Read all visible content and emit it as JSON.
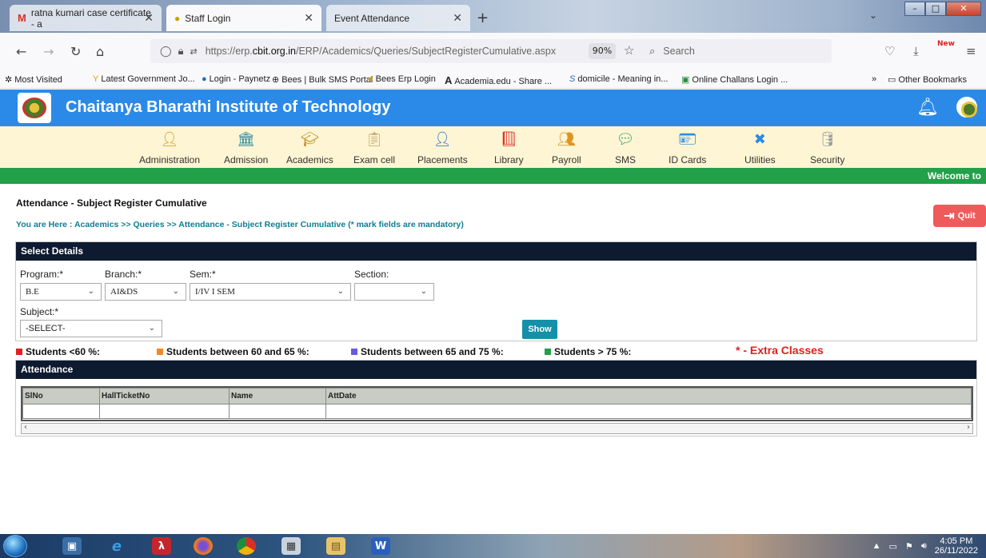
{
  "browser": {
    "tabs": [
      {
        "label": "ratna kumari case certificate - a"
      },
      {
        "label": "Staff Login"
      },
      {
        "label": "Event Attendance"
      }
    ],
    "url_prefix": "https://erp.",
    "url_domain": "cbit.org.in",
    "url_path": "/ERP/Academics/Queries/SubjectRegisterCumulative.aspx",
    "zoom": "90%",
    "search_placeholder": "Search",
    "new_badge": "New",
    "bookmarks": [
      "Most Visited",
      "Latest Government Jo...",
      "Login - Paynetz",
      "Bees | Bulk SMS Portal",
      "Bees Erp Login",
      "Academia.edu - Share ...",
      "domicile - Meaning in...",
      "Online Challans Login ..."
    ],
    "other_bookmarks": "Other Bookmarks"
  },
  "app": {
    "title": "Chaitanya Bharathi Institute of Technology",
    "welcome": "Welcome to",
    "modules": [
      "Administration",
      "Admission",
      "Academics",
      "Exam cell",
      "Placements",
      "Library",
      "Payroll",
      "SMS",
      "ID Cards",
      "Utilities",
      "Security"
    ]
  },
  "page": {
    "title": "Attendance - Subject Register Cumulative",
    "breadcrumb": "You are Here : Academics >> Queries >> Attendance - Subject Register Cumulative (* mark fields are mandatory)",
    "quit": "Quit"
  },
  "details": {
    "heading": "Select Details",
    "program_label": "Program:*",
    "program_value": "B.E",
    "branch_label": "Branch:*",
    "branch_value": "AI&DS",
    "sem_label": "Sem:*",
    "sem_value": "I/IV I SEM",
    "section_label": "Section:",
    "section_value": "",
    "subject_label": "Subject:*",
    "subject_value": "-SELECT-",
    "show": "Show"
  },
  "legend": {
    "items": [
      {
        "label": "Students <60 %:",
        "color": "#e02020"
      },
      {
        "label": "Students between 60 and 65 %:",
        "color": "#f08a24"
      },
      {
        "label": "Students between 65 and 75 %:",
        "color": "#6a5ae0"
      },
      {
        "label": "Students > 75 %:",
        "color": "#22a04a"
      }
    ],
    "extra": "* - Extra Classes"
  },
  "attendance": {
    "heading": "Attendance",
    "columns": [
      "SlNo",
      "HallTicketNo",
      "Name",
      "AttDate"
    ]
  },
  "taskbar": {
    "time": "4:05 PM",
    "date": "26/11/2022"
  }
}
